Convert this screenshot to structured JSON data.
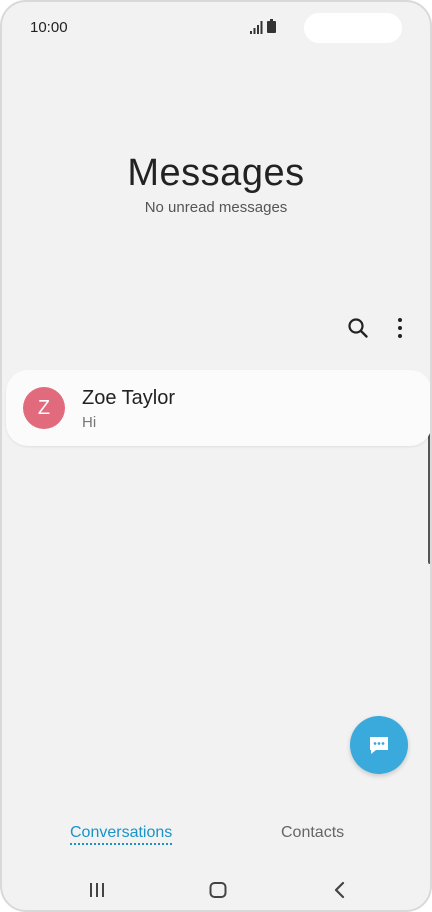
{
  "status_bar": {
    "time": "10:00"
  },
  "header": {
    "title": "Messages",
    "subtitle": "No unread messages"
  },
  "toolbar": {
    "search_icon": "search-icon",
    "more_icon": "more-options-icon"
  },
  "conversations": [
    {
      "avatar_initial": "Z",
      "avatar_color": "#e26a7d",
      "name": "Zoe Taylor",
      "preview": "Hi"
    }
  ],
  "fab": {
    "icon": "compose-message-icon",
    "color": "#3aa9dc"
  },
  "tabs": [
    {
      "label": "Conversations",
      "active": true
    },
    {
      "label": "Contacts",
      "active": false
    }
  ],
  "navigation": {
    "recents_icon": "recent-apps-icon",
    "home_icon": "home-icon",
    "back_icon": "back-icon"
  },
  "colors": {
    "accent": "#1a93c7",
    "background": "#f2f2f2"
  }
}
